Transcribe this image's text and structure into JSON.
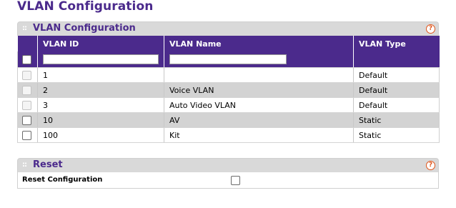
{
  "page": {
    "title": "VLAN Configuration"
  },
  "vlan_panel": {
    "title": "VLAN Configuration",
    "help_icon": "help-icon",
    "columns": [
      "VLAN ID",
      "VLAN Name",
      "VLAN Type"
    ],
    "filter": {
      "vlan_id": "",
      "vlan_name": ""
    },
    "rows": [
      {
        "id": "1",
        "name": "",
        "type": "Default",
        "checkbox_enabled": false
      },
      {
        "id": "2",
        "name": "Voice VLAN",
        "type": "Default",
        "checkbox_enabled": false
      },
      {
        "id": "3",
        "name": "Auto Video VLAN",
        "type": "Default",
        "checkbox_enabled": false
      },
      {
        "id": "10",
        "name": "AV",
        "type": "Static",
        "checkbox_enabled": true
      },
      {
        "id": "100",
        "name": "Kit",
        "type": "Static",
        "checkbox_enabled": true
      }
    ]
  },
  "reset_panel": {
    "title": "Reset",
    "help_icon": "help-icon",
    "label": "Reset Configuration"
  },
  "colors": {
    "accent": "#4b2a8c",
    "help": "#e0551b",
    "row_alt": "#d3d3d3",
    "header_bar": "#d9d9d9"
  }
}
